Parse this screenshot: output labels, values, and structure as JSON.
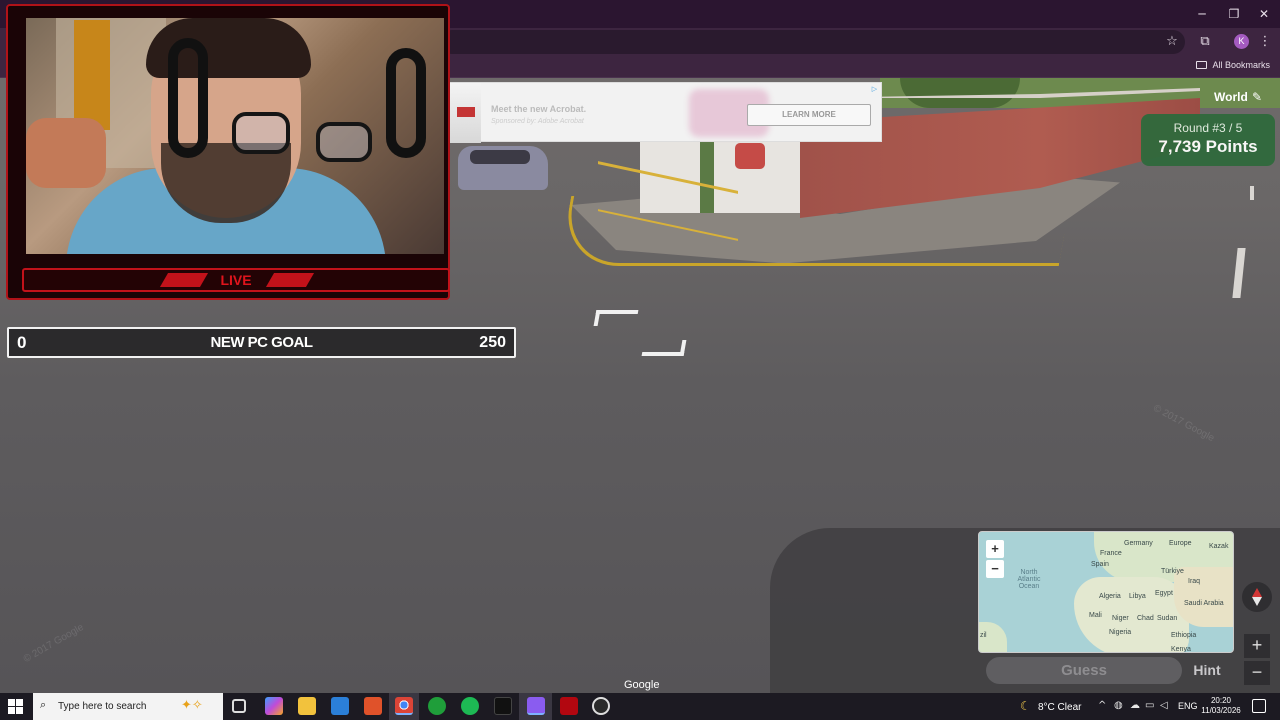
{
  "browser": {
    "window_controls": {
      "minimize": "─",
      "restore": "❐",
      "close": "✕"
    },
    "toolbar_icons": {
      "bookmark_star": "☆",
      "extensions": "⧉",
      "menu": "⋮"
    },
    "profile_initial": "K",
    "bookmarks_bar": {
      "all_bookmarks_label": "All Bookmarks"
    }
  },
  "ad": {
    "title": "Meet the new Acrobat.",
    "sponsor": "Sponsored by: Adobe Acrobat",
    "button_label": "LEARN MORE",
    "choices_icon": "▷"
  },
  "stream_overlay": {
    "live_label": "LIVE",
    "goal": {
      "start": "0",
      "label": "NEW PC GOAL",
      "end": "250"
    }
  },
  "game": {
    "map_name": "World",
    "edit_icon": "✎",
    "round_text": "Round #3 / 5",
    "points_text": "7,739 Points",
    "minimap": {
      "zoom_in": "+",
      "zoom_out": "−",
      "labels": {
        "france": "France",
        "germany": "Germany",
        "spain": "Spain",
        "europe": "Europe",
        "kazak": "Kazak",
        "turkiye": "Türkiye",
        "iraq": "Iraq",
        "north_atlantic": "North Atlantic Ocean",
        "algeria": "Algeria",
        "libya": "Libya",
        "egypt": "Egypt",
        "saudi_arabia": "Saudi Arabia",
        "mali": "Mali",
        "niger": "Niger",
        "chad": "Chad",
        "sudan": "Sudan",
        "nigeria": "Nigeria",
        "ethiopia": "Ethiopia",
        "kenya": "Kenya",
        "brazil_partial": "zil"
      }
    },
    "guess_label": "Guess",
    "hint_label": "Hint",
    "sv_zoom_in": "+",
    "sv_zoom_out": "−",
    "google_attribution": "Google"
  },
  "taskbar": {
    "search_icon": "⌕",
    "search_placeholder": "Type here to search",
    "search_sparkle": "✦✧",
    "weather": {
      "icon": "☾",
      "text": "8°C  Clear"
    },
    "tray_chevron": "^",
    "language": "ENG",
    "time": "20:20",
    "date": "11/03/2026"
  },
  "colors": {
    "score_green": "#2f6a3c",
    "overlay_red": "#c2121a",
    "browser_bg": "#3d2540"
  }
}
